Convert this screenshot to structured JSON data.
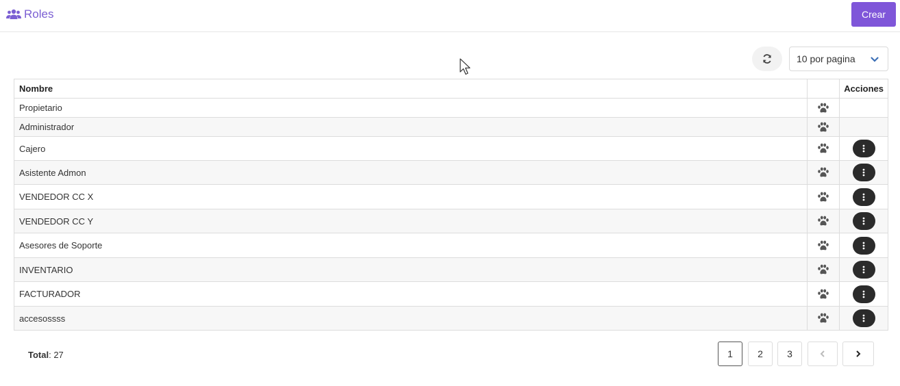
{
  "header": {
    "title": "Roles",
    "title_icon": "users-icon",
    "create_label": "Crear",
    "accent": "#7f56d9"
  },
  "toolbar": {
    "refresh_icon": "refresh-icon",
    "per_page": "10 por pagina"
  },
  "table": {
    "columns": [
      "Nombre",
      "",
      "Acciones"
    ],
    "rows": [
      {
        "name": "Propietario",
        "has_actions": false
      },
      {
        "name": "Administrador",
        "has_actions": false
      },
      {
        "name": "Cajero",
        "has_actions": true
      },
      {
        "name": "Asistente Admon",
        "has_actions": true
      },
      {
        "name": "VENDEDOR CC X",
        "has_actions": true
      },
      {
        "name": "VENDEDOR CC Y",
        "has_actions": true
      },
      {
        "name": "Asesores de Soporte",
        "has_actions": true
      },
      {
        "name": "INVENTARIO",
        "has_actions": true
      },
      {
        "name": "FACTURADOR",
        "has_actions": true
      },
      {
        "name": "accesossss",
        "has_actions": true
      }
    ]
  },
  "footer": {
    "total_label": "Total",
    "total_value": ": 27",
    "pages": [
      "1",
      "2",
      "3"
    ],
    "current_page": "1"
  }
}
